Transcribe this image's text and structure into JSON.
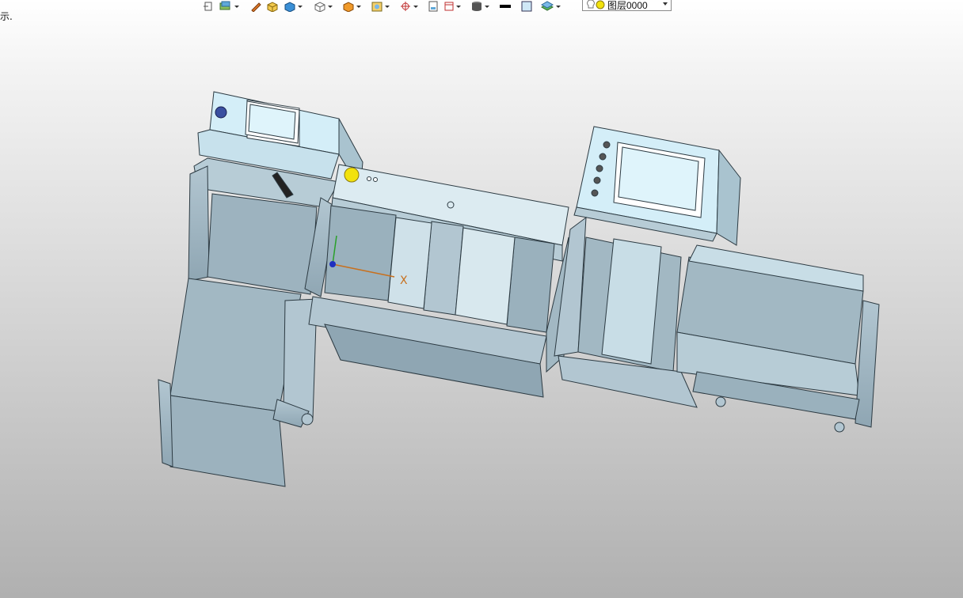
{
  "status": {
    "text": "示."
  },
  "toolbar": {
    "icons": [
      "exit-icon",
      "layers-icon",
      "pencil-icon",
      "box-icon",
      "solid-icon",
      "cube-view-icon",
      "shade-icon",
      "render-icon",
      "snap-icon",
      "page-icon",
      "frame-icon",
      "cylinder-icon",
      "line-color-icon",
      "fill-color-icon",
      "layer-stack-icon"
    ],
    "layer_select": {
      "value": "图层0000"
    }
  },
  "viewport": {
    "axis_x_label": "X",
    "accent": "#c8701e",
    "metal_color": "#9fb5c2",
    "screen_color": "#dff4fb",
    "indicator_color": "#f2e20d"
  }
}
